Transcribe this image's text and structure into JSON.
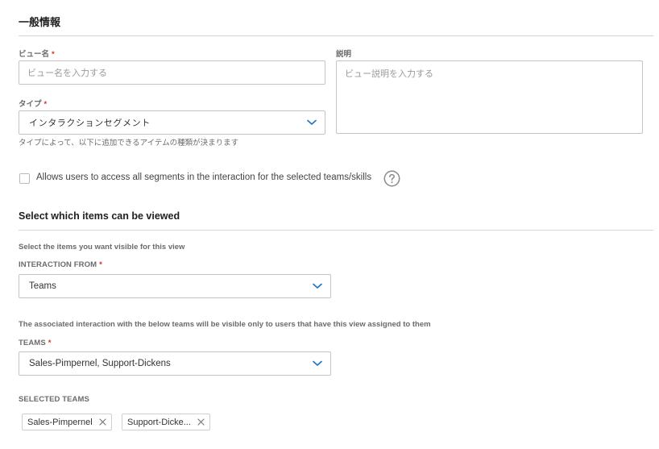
{
  "general": {
    "title": "一般情報",
    "view_name": {
      "label": "ビュー名",
      "required": "*",
      "placeholder": "ビュー名を入力する",
      "value": ""
    },
    "description": {
      "label": "説明",
      "placeholder": "ビュー説明を入力する",
      "value": ""
    },
    "type": {
      "label": "タイプ",
      "required": "*",
      "selected": "インタラクションセグメント",
      "helper": "タイプによって、以下に追加できるアイテムの種類が決まります"
    },
    "access_all": {
      "checked": false,
      "label": "Allows users to access all segments in the interaction for the selected teams/skills",
      "help_icon": "question-circle-icon"
    }
  },
  "items": {
    "title": "Select which items can be viewed",
    "subtitle": "Select the items you want visible for this view",
    "interaction_from": {
      "label": "INTERACTION FROM",
      "required": "*",
      "selected": "Teams"
    },
    "teams_note": "The associated interaction with the below teams will be visible only to users that have this view assigned to them",
    "teams": {
      "label": "TEAMS",
      "required": "*",
      "selected": "Sales-Pimpernel, Support-Dickens"
    },
    "selected_teams": {
      "label": "SELECTED TEAMS",
      "chips": [
        {
          "label": "Sales-Pimpernel",
          "remove_icon": "close-icon"
        },
        {
          "label": "Support-Dicke...",
          "remove_icon": "close-icon"
        }
      ]
    }
  },
  "colors": {
    "accent": "#1a73c8",
    "required": "#d32f2f",
    "border": "#c4c4c4",
    "divider": "#d6d6d6"
  }
}
